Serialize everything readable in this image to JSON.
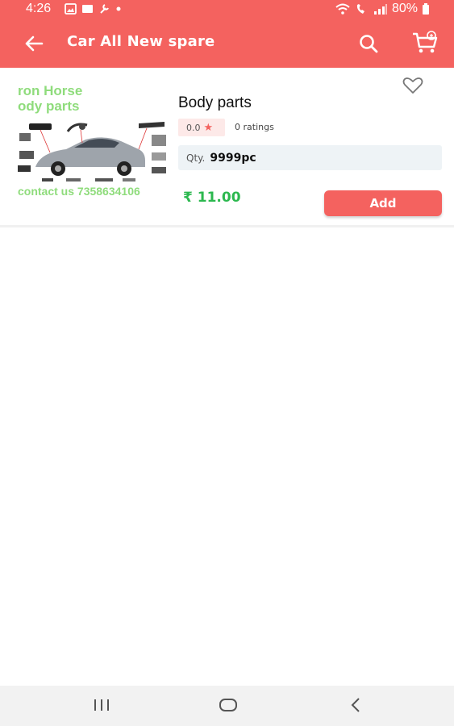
{
  "status_bar": {
    "time": "4:26",
    "battery": "80%"
  },
  "app_bar": {
    "title": "Car All New spare",
    "icons": [
      "back-arrow-icon",
      "search-icon",
      "cart-icon"
    ],
    "background_color": "#f4625f"
  },
  "product": {
    "image_text": {
      "line1": "ron Horse",
      "line2": "ody parts",
      "contact": "contact us  7358634106"
    },
    "title": "Body parts",
    "rating": "0.0",
    "ratings_count": "0 ratings",
    "qty_label": "Qty.",
    "qty_value": "9999pc",
    "price": "₹ 11.00",
    "add_label": "Add",
    "price_color": "#2cb84f"
  },
  "nav_bar": {
    "buttons": [
      "recent-apps-icon",
      "home-icon",
      "back-icon"
    ]
  }
}
